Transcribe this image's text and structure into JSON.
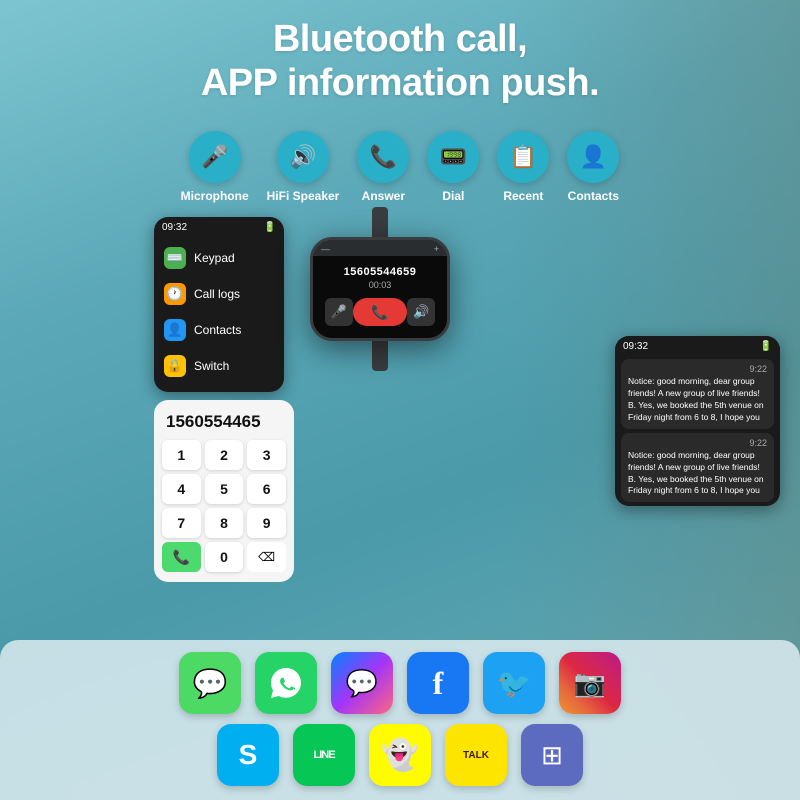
{
  "header": {
    "title_line1": "Bluetooth call,",
    "title_line2": "APP information push."
  },
  "features": [
    {
      "label": "Microphone",
      "icon": "🎤",
      "color": "#29afc8"
    },
    {
      "label": "HiFi Speaker",
      "icon": "🔊",
      "color": "#29afc8"
    },
    {
      "label": "Answer",
      "icon": "📞",
      "color": "#29afc8"
    },
    {
      "label": "Dial",
      "icon": "📟",
      "color": "#29afc8"
    },
    {
      "label": "Recent",
      "icon": "📋",
      "color": "#29afc8"
    },
    {
      "label": "Contacts",
      "icon": "👤",
      "color": "#29afc8"
    }
  ],
  "menu": {
    "time": "09:32",
    "items": [
      {
        "label": "Keypad",
        "icon": "⌨️",
        "color": "#4caf50"
      },
      {
        "label": "Call logs",
        "icon": "🕐",
        "color": "#ff9800"
      },
      {
        "label": "Contacts",
        "icon": "👤",
        "color": "#2196f3"
      },
      {
        "label": "Switch",
        "icon": "🔒",
        "color": "#ffc107"
      }
    ]
  },
  "dial": {
    "number": "1560554465",
    "keys": [
      "1",
      "2",
      "3",
      "4",
      "5",
      "6",
      "7",
      "8",
      "9",
      "*",
      "0",
      "⌫"
    ]
  },
  "watch": {
    "call_number": "15605544659",
    "duration": "00:03"
  },
  "notifications": {
    "time": "09:32",
    "items": [
      {
        "time": "9:22",
        "text": "Notice: good morning, dear group friends! A new group of live friends! B. Yes, we booked the 5th venue on Friday night from 6 to 8, I hope you"
      },
      {
        "time": "9:22",
        "text": "Notice: good morning, dear group friends! A new group of live friends! B. Yes, we booked the 5th venue on Friday night from 6 to 8, I hope you"
      }
    ]
  },
  "apps_row1": [
    {
      "name": "Messages",
      "icon": "💬",
      "bg": "#4cd964"
    },
    {
      "name": "WhatsApp",
      "icon": "📱",
      "bg": "#25d366"
    },
    {
      "name": "Messenger",
      "icon": "💭",
      "bg": "#0084ff"
    },
    {
      "name": "Facebook",
      "icon": "f",
      "bg": "#1877f2"
    },
    {
      "name": "Twitter",
      "icon": "🐦",
      "bg": "#1da1f2"
    },
    {
      "name": "Instagram",
      "icon": "📷",
      "bg": "#e1306c"
    }
  ],
  "apps_row2": [
    {
      "name": "Skype",
      "icon": "S",
      "bg": "#00aff0"
    },
    {
      "name": "LINE",
      "icon": "LINE",
      "bg": "#06c755"
    },
    {
      "name": "Snapchat",
      "icon": "👻",
      "bg": "#fffc00"
    },
    {
      "name": "KakaoTalk",
      "icon": "TALK",
      "bg": "#fee500"
    },
    {
      "name": "Grid App",
      "icon": "⊞",
      "bg": "#5c6bc0"
    }
  ],
  "colors": {
    "bg_start": "#7dc5d0",
    "bg_end": "#4a9aaa",
    "accent": "#29afc8",
    "white": "#ffffff",
    "dark": "#1a1a1a",
    "red": "#e53935",
    "green": "#4cd964"
  }
}
